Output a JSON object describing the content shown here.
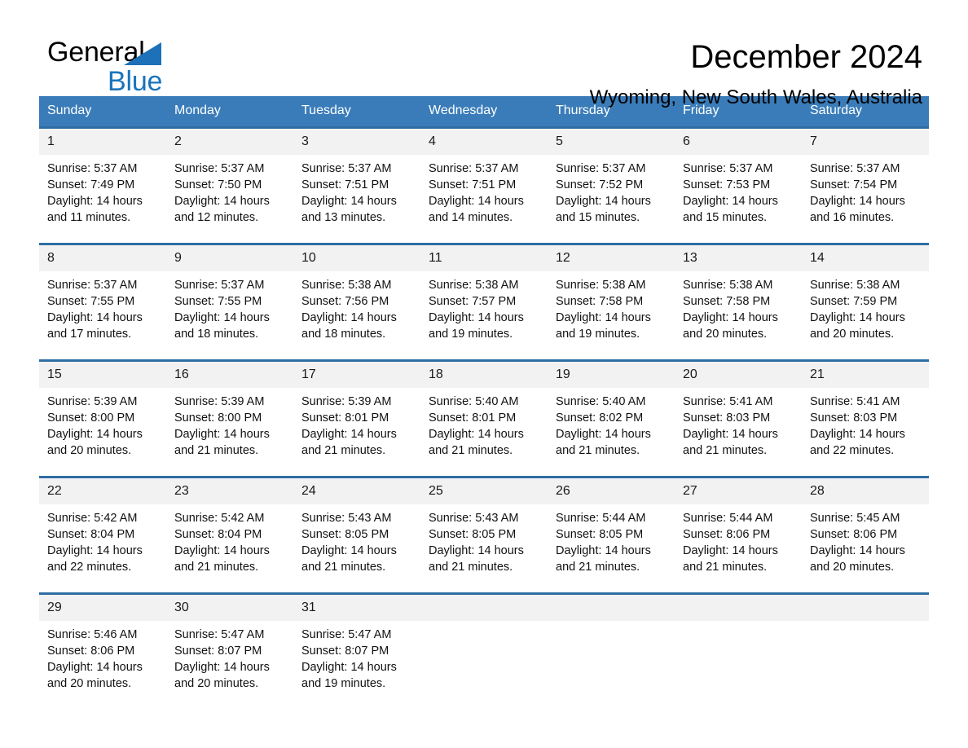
{
  "brand": {
    "name_part1": "General",
    "name_part2": "Blue",
    "flag_icon": "triangle-flag-icon"
  },
  "header": {
    "title": "December 2024",
    "subtitle": "Wyoming, New South Wales, Australia"
  },
  "colors": {
    "header_blue": "#3a7cb9",
    "separator_blue": "#2e6da4",
    "date_band_gray": "#f2f2f2",
    "brand_blue": "#1974bb"
  },
  "weekdays": [
    "Sunday",
    "Monday",
    "Tuesday",
    "Wednesday",
    "Thursday",
    "Friday",
    "Saturday"
  ],
  "weeks": [
    {
      "dates": [
        "1",
        "2",
        "3",
        "4",
        "5",
        "6",
        "7"
      ],
      "cells": [
        {
          "sunrise": "Sunrise: 5:37 AM",
          "sunset": "Sunset: 7:49 PM",
          "daylight1": "Daylight: 14 hours",
          "daylight2": "and 11 minutes."
        },
        {
          "sunrise": "Sunrise: 5:37 AM",
          "sunset": "Sunset: 7:50 PM",
          "daylight1": "Daylight: 14 hours",
          "daylight2": "and 12 minutes."
        },
        {
          "sunrise": "Sunrise: 5:37 AM",
          "sunset": "Sunset: 7:51 PM",
          "daylight1": "Daylight: 14 hours",
          "daylight2": "and 13 minutes."
        },
        {
          "sunrise": "Sunrise: 5:37 AM",
          "sunset": "Sunset: 7:51 PM",
          "daylight1": "Daylight: 14 hours",
          "daylight2": "and 14 minutes."
        },
        {
          "sunrise": "Sunrise: 5:37 AM",
          "sunset": "Sunset: 7:52 PM",
          "daylight1": "Daylight: 14 hours",
          "daylight2": "and 15 minutes."
        },
        {
          "sunrise": "Sunrise: 5:37 AM",
          "sunset": "Sunset: 7:53 PM",
          "daylight1": "Daylight: 14 hours",
          "daylight2": "and 15 minutes."
        },
        {
          "sunrise": "Sunrise: 5:37 AM",
          "sunset": "Sunset: 7:54 PM",
          "daylight1": "Daylight: 14 hours",
          "daylight2": "and 16 minutes."
        }
      ]
    },
    {
      "dates": [
        "8",
        "9",
        "10",
        "11",
        "12",
        "13",
        "14"
      ],
      "cells": [
        {
          "sunrise": "Sunrise: 5:37 AM",
          "sunset": "Sunset: 7:55 PM",
          "daylight1": "Daylight: 14 hours",
          "daylight2": "and 17 minutes."
        },
        {
          "sunrise": "Sunrise: 5:37 AM",
          "sunset": "Sunset: 7:55 PM",
          "daylight1": "Daylight: 14 hours",
          "daylight2": "and 18 minutes."
        },
        {
          "sunrise": "Sunrise: 5:38 AM",
          "sunset": "Sunset: 7:56 PM",
          "daylight1": "Daylight: 14 hours",
          "daylight2": "and 18 minutes."
        },
        {
          "sunrise": "Sunrise: 5:38 AM",
          "sunset": "Sunset: 7:57 PM",
          "daylight1": "Daylight: 14 hours",
          "daylight2": "and 19 minutes."
        },
        {
          "sunrise": "Sunrise: 5:38 AM",
          "sunset": "Sunset: 7:58 PM",
          "daylight1": "Daylight: 14 hours",
          "daylight2": "and 19 minutes."
        },
        {
          "sunrise": "Sunrise: 5:38 AM",
          "sunset": "Sunset: 7:58 PM",
          "daylight1": "Daylight: 14 hours",
          "daylight2": "and 20 minutes."
        },
        {
          "sunrise": "Sunrise: 5:38 AM",
          "sunset": "Sunset: 7:59 PM",
          "daylight1": "Daylight: 14 hours",
          "daylight2": "and 20 minutes."
        }
      ]
    },
    {
      "dates": [
        "15",
        "16",
        "17",
        "18",
        "19",
        "20",
        "21"
      ],
      "cells": [
        {
          "sunrise": "Sunrise: 5:39 AM",
          "sunset": "Sunset: 8:00 PM",
          "daylight1": "Daylight: 14 hours",
          "daylight2": "and 20 minutes."
        },
        {
          "sunrise": "Sunrise: 5:39 AM",
          "sunset": "Sunset: 8:00 PM",
          "daylight1": "Daylight: 14 hours",
          "daylight2": "and 21 minutes."
        },
        {
          "sunrise": "Sunrise: 5:39 AM",
          "sunset": "Sunset: 8:01 PM",
          "daylight1": "Daylight: 14 hours",
          "daylight2": "and 21 minutes."
        },
        {
          "sunrise": "Sunrise: 5:40 AM",
          "sunset": "Sunset: 8:01 PM",
          "daylight1": "Daylight: 14 hours",
          "daylight2": "and 21 minutes."
        },
        {
          "sunrise": "Sunrise: 5:40 AM",
          "sunset": "Sunset: 8:02 PM",
          "daylight1": "Daylight: 14 hours",
          "daylight2": "and 21 minutes."
        },
        {
          "sunrise": "Sunrise: 5:41 AM",
          "sunset": "Sunset: 8:03 PM",
          "daylight1": "Daylight: 14 hours",
          "daylight2": "and 21 minutes."
        },
        {
          "sunrise": "Sunrise: 5:41 AM",
          "sunset": "Sunset: 8:03 PM",
          "daylight1": "Daylight: 14 hours",
          "daylight2": "and 22 minutes."
        }
      ]
    },
    {
      "dates": [
        "22",
        "23",
        "24",
        "25",
        "26",
        "27",
        "28"
      ],
      "cells": [
        {
          "sunrise": "Sunrise: 5:42 AM",
          "sunset": "Sunset: 8:04 PM",
          "daylight1": "Daylight: 14 hours",
          "daylight2": "and 22 minutes."
        },
        {
          "sunrise": "Sunrise: 5:42 AM",
          "sunset": "Sunset: 8:04 PM",
          "daylight1": "Daylight: 14 hours",
          "daylight2": "and 21 minutes."
        },
        {
          "sunrise": "Sunrise: 5:43 AM",
          "sunset": "Sunset: 8:05 PM",
          "daylight1": "Daylight: 14 hours",
          "daylight2": "and 21 minutes."
        },
        {
          "sunrise": "Sunrise: 5:43 AM",
          "sunset": "Sunset: 8:05 PM",
          "daylight1": "Daylight: 14 hours",
          "daylight2": "and 21 minutes."
        },
        {
          "sunrise": "Sunrise: 5:44 AM",
          "sunset": "Sunset: 8:05 PM",
          "daylight1": "Daylight: 14 hours",
          "daylight2": "and 21 minutes."
        },
        {
          "sunrise": "Sunrise: 5:44 AM",
          "sunset": "Sunset: 8:06 PM",
          "daylight1": "Daylight: 14 hours",
          "daylight2": "and 21 minutes."
        },
        {
          "sunrise": "Sunrise: 5:45 AM",
          "sunset": "Sunset: 8:06 PM",
          "daylight1": "Daylight: 14 hours",
          "daylight2": "and 20 minutes."
        }
      ]
    },
    {
      "dates": [
        "29",
        "30",
        "31",
        "",
        "",
        "",
        ""
      ],
      "cells": [
        {
          "sunrise": "Sunrise: 5:46 AM",
          "sunset": "Sunset: 8:06 PM",
          "daylight1": "Daylight: 14 hours",
          "daylight2": "and 20 minutes."
        },
        {
          "sunrise": "Sunrise: 5:47 AM",
          "sunset": "Sunset: 8:07 PM",
          "daylight1": "Daylight: 14 hours",
          "daylight2": "and 20 minutes."
        },
        {
          "sunrise": "Sunrise: 5:47 AM",
          "sunset": "Sunset: 8:07 PM",
          "daylight1": "Daylight: 14 hours",
          "daylight2": "and 19 minutes."
        },
        {
          "sunrise": "",
          "sunset": "",
          "daylight1": "",
          "daylight2": ""
        },
        {
          "sunrise": "",
          "sunset": "",
          "daylight1": "",
          "daylight2": ""
        },
        {
          "sunrise": "",
          "sunset": "",
          "daylight1": "",
          "daylight2": ""
        },
        {
          "sunrise": "",
          "sunset": "",
          "daylight1": "",
          "daylight2": ""
        }
      ]
    }
  ]
}
